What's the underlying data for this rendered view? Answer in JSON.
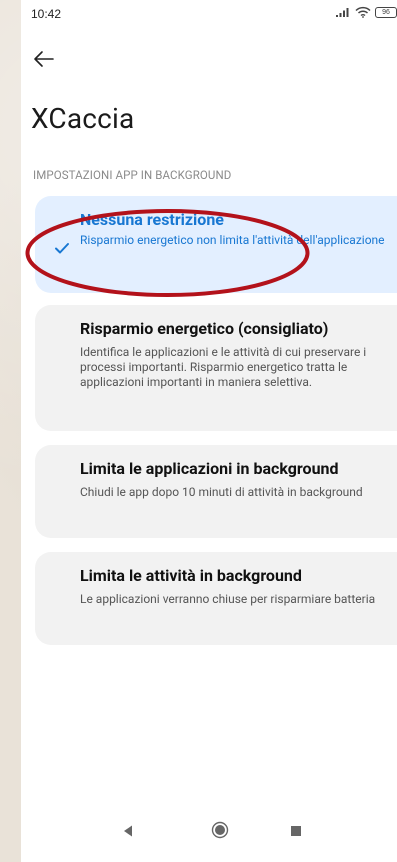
{
  "status_bar": {
    "time": "10:42",
    "battery": "96",
    "icons": [
      "signal-icon",
      "wifi-icon",
      "battery-icon"
    ]
  },
  "header": {
    "back_icon": "arrow-left-icon",
    "title": "XCaccia"
  },
  "section": {
    "label": "IMPOSTAZIONI APP IN BACKGROUND"
  },
  "options": [
    {
      "title": "Nessuna restrizione",
      "description": "Risparmio energetico non limita l'attività dell'applicazione",
      "selected": true
    },
    {
      "title": "Risparmio energetico (consigliato)",
      "description": "Identifica le applicazioni e le attività di cui preservare i processi importanti. Risparmio energetico tratta le applicazioni importanti in maniera selettiva.",
      "selected": false
    },
    {
      "title": "Limita le applicazioni in background",
      "description": "Chiudi le app dopo 10 minuti di attività in background",
      "selected": false
    },
    {
      "title": "Limita le attività in background",
      "description": "Le applicazioni verranno chiuse per risparmiare batteria",
      "selected": false
    }
  ],
  "colors": {
    "accent": "#1877d2",
    "selected_bg": "#e3efff",
    "card_bg": "#f2f2f2",
    "annotation": "#b3121b",
    "frame_bg": "#e9e2d8"
  },
  "navigation_bar": {
    "icons": [
      "nav-back-icon",
      "nav-home-icon",
      "nav-recents-icon"
    ]
  }
}
